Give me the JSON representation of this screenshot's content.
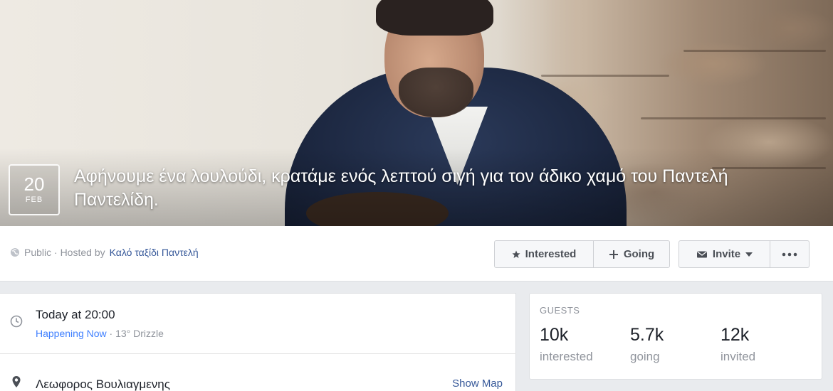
{
  "event": {
    "date_day": "20",
    "date_month": "FEB",
    "title": "Αφήνουμε ένα λουλούδι, κρατάμε ενός λεπτού σιγή για τον άδικο χαμό του Παντελή Παντελίδη."
  },
  "host": {
    "privacy": "Public · Hosted by",
    "name": "Καλό ταξίδι Παντελή"
  },
  "actions": {
    "interested": "Interested",
    "going": "Going",
    "invite": "Invite",
    "more": "···"
  },
  "details": {
    "time": "Today at 20:00",
    "happening": "Happening Now",
    "weather": " · 13° Drizzle",
    "location": "Λεωφορος Βουλιαγμενης",
    "show_map": "Show Map"
  },
  "guests": {
    "title": "GUESTS",
    "stats": [
      {
        "value": "10k",
        "label": "interested"
      },
      {
        "value": "5.7k",
        "label": "going"
      },
      {
        "value": "12k",
        "label": "invited"
      }
    ]
  },
  "colors": {
    "link": "#365899",
    "happening": "#4080ff",
    "muted": "#90949c"
  }
}
